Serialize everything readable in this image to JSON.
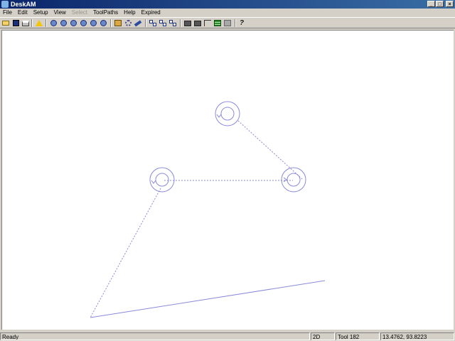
{
  "window": {
    "title": "DeskAM"
  },
  "menu": [
    {
      "label": "File",
      "enabled": true
    },
    {
      "label": "Edit",
      "enabled": true
    },
    {
      "label": "Setup",
      "enabled": true
    },
    {
      "label": "View",
      "enabled": true
    },
    {
      "label": "Select",
      "enabled": false
    },
    {
      "label": "ToolPaths",
      "enabled": true
    },
    {
      "label": "Help",
      "enabled": true
    },
    {
      "label": "Expired",
      "enabled": true
    }
  ],
  "toolbar": {
    "icons": [
      "open-folder-icon",
      "save-icon",
      "print-icon",
      "warning-icon",
      "zoom-in-icon",
      "zoom-out-icon",
      "zoom-window-icon",
      "zoom-extents-icon",
      "zoom-previous-icon",
      "zoom-all-icon",
      "package-icon",
      "gear-icon",
      "pen-icon",
      "nodes-icon",
      "nodes-select-icon",
      "nodes-active-icon",
      "machine-icon",
      "machine-run-icon",
      "arrow-down-icon",
      "green-layer-icon",
      "gray-layer-icon",
      "help-icon"
    ]
  },
  "drawing": {
    "stroke_color": "#8a8ad8"
  },
  "statusbar": {
    "message": "Ready",
    "mode": "2D",
    "tool": "Tool 182",
    "coords": "13.4762, 93.8223"
  }
}
